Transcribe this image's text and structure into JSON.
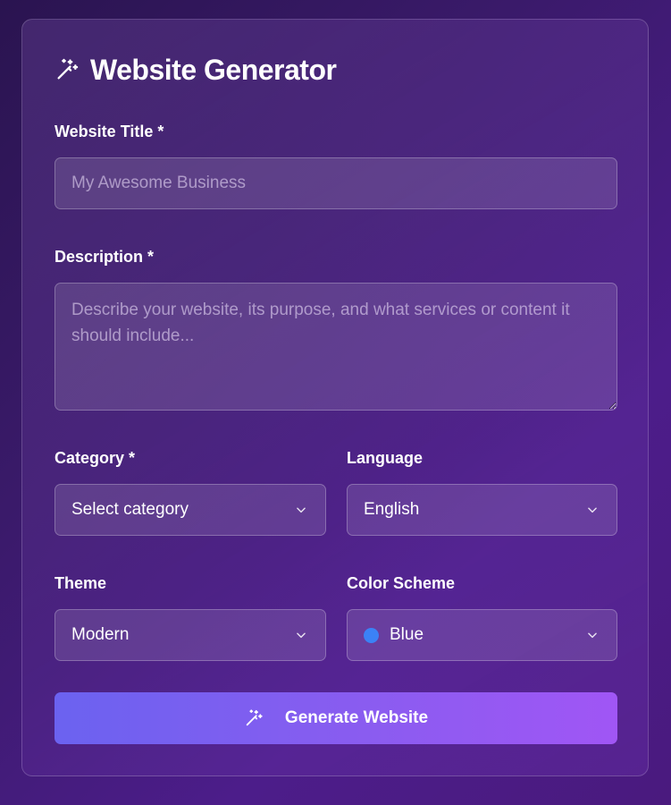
{
  "header": {
    "title": "Website Generator",
    "icon": "magic-wand-icon"
  },
  "form": {
    "website_title": {
      "label": "Website Title *",
      "value": "",
      "placeholder": "My Awesome Business"
    },
    "description": {
      "label": "Description *",
      "value": "",
      "placeholder": "Describe your website, its purpose, and what services or content it should include..."
    },
    "category": {
      "label": "Category *",
      "value": "Select category",
      "icon": "chevron-down-icon"
    },
    "language": {
      "label": "Language",
      "value": "English",
      "icon": "chevron-down-icon"
    },
    "theme": {
      "label": "Theme",
      "value": "Modern",
      "icon": "chevron-down-icon"
    },
    "color_scheme": {
      "label": "Color Scheme",
      "value": "Blue",
      "swatch_color": "#3b82f6",
      "icon": "chevron-down-icon"
    },
    "generate_button": {
      "label": "Generate Website",
      "icon": "magic-wand-icon"
    }
  },
  "colors": {
    "button_gradient_start": "#6b62f0",
    "button_gradient_end": "#a056f5"
  }
}
